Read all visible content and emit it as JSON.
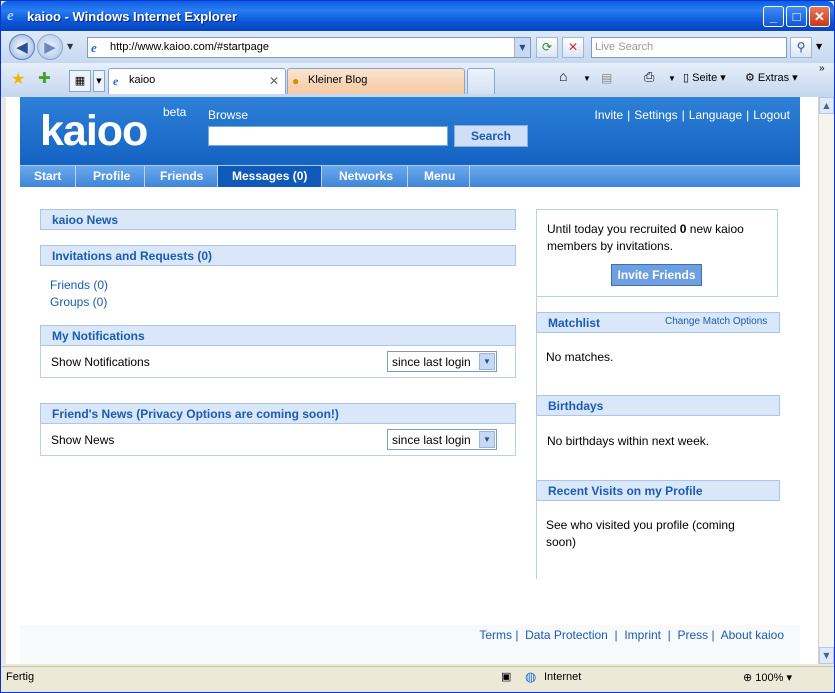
{
  "window": {
    "title": "kaioo - Windows Internet Explorer",
    "minimize": "_",
    "maximize": "□",
    "close": "✕"
  },
  "address": {
    "url": "http://www.kaioo.com/#startpage",
    "search_placeholder": "Live Search"
  },
  "tabs": [
    {
      "label": "kaioo"
    },
    {
      "label": "Kleiner Blog"
    }
  ],
  "toolbar": {
    "page": "Seite",
    "extras": "Extras"
  },
  "site": {
    "logo": "kaioo",
    "beta": "beta",
    "browse_label": "Browse",
    "search_button": "Search",
    "top_links": [
      "Invite",
      "Settings",
      "Language",
      "Logout"
    ],
    "menu": [
      "Start",
      "Profile",
      "Friends",
      "Messages (0)",
      "Networks",
      "Menu"
    ]
  },
  "left": {
    "news_title": "kaioo News",
    "invitations_title": "Invitations and Requests (0)",
    "friends_link": "Friends (0)",
    "groups_link": "Groups (0)",
    "notifications_title": "My Notifications",
    "show_notifications": "Show Notifications",
    "notifications_select": "since last login",
    "friends_news_title": "Friend's News (Privacy Options are coming soon!)",
    "show_news": "Show News",
    "news_select": "since last login"
  },
  "right": {
    "recruit_pre": "Until today you recruited",
    "recruit_count": "0",
    "recruit_post": "new kaioo",
    "recruit_line2": "members by invitations.",
    "invite_button": "Invite Friends",
    "matchlist_title": "Matchlist",
    "change_match": "Change Match Options",
    "no_matches": "No matches.",
    "birthdays_title": "Birthdays",
    "no_birthdays": "No birthdays within next week.",
    "visits_title": "Recent Visits on my Profile",
    "visits_line1": "See who visited you profile (coming",
    "visits_line2": "soon)"
  },
  "footer": {
    "links": [
      "Terms",
      "Data Protection",
      "Imprint",
      "Press",
      "About kaioo"
    ]
  },
  "status": {
    "left": "Fertig",
    "zone": "Internet",
    "zoom": "100%"
  }
}
